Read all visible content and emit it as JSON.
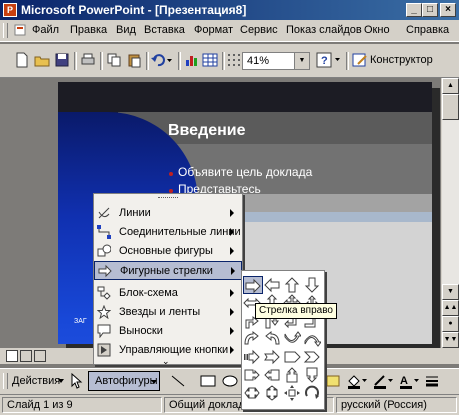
{
  "window": {
    "title": "Microsoft PowerPoint - [Презентация8]"
  },
  "menu": [
    "Файл",
    "Правка",
    "Вид",
    "Вставка",
    "Формат",
    "Сервис",
    "Показ слайдов",
    "Окно",
    "Справка"
  ],
  "toolbar": {
    "zoom": "41%",
    "designer_label": "Конструктор"
  },
  "slide": {
    "title": "Введение",
    "bullets": [
      "Объявите цель доклада",
      "Представьтесь"
    ],
    "footer_text": "ЗАГ"
  },
  "autoshapes_menu": {
    "items": [
      {
        "label": "Линии",
        "icon": "lines-icon",
        "highlighted": false
      },
      {
        "label": "Соединительные линии",
        "icon": "connectors-icon",
        "highlighted": false
      },
      {
        "label": "Основные фигуры",
        "icon": "basic-shapes-icon",
        "highlighted": false
      },
      {
        "label": "Фигурные стрелки",
        "icon": "block-arrows-icon",
        "highlighted": true
      },
      {
        "label": "Блок-схема",
        "icon": "flowchart-icon",
        "highlighted": false
      },
      {
        "label": "Звезды и ленты",
        "icon": "stars-icon",
        "highlighted": false
      },
      {
        "label": "Выноски",
        "icon": "callouts-icon",
        "highlighted": false
      },
      {
        "label": "Управляющие кнопки",
        "icon": "action-buttons-icon",
        "highlighted": false
      }
    ]
  },
  "palette": {
    "tooltip": "Стрелка вправо",
    "selected": "right-arrow-icon"
  },
  "drawing_toolbar": {
    "actions_label": "Действия",
    "autoshapes_label": "Автофигуры"
  },
  "status": {
    "slide": "Слайд 1 из 9",
    "design": "Общий доклад",
    "language": "русский (Россия)"
  }
}
